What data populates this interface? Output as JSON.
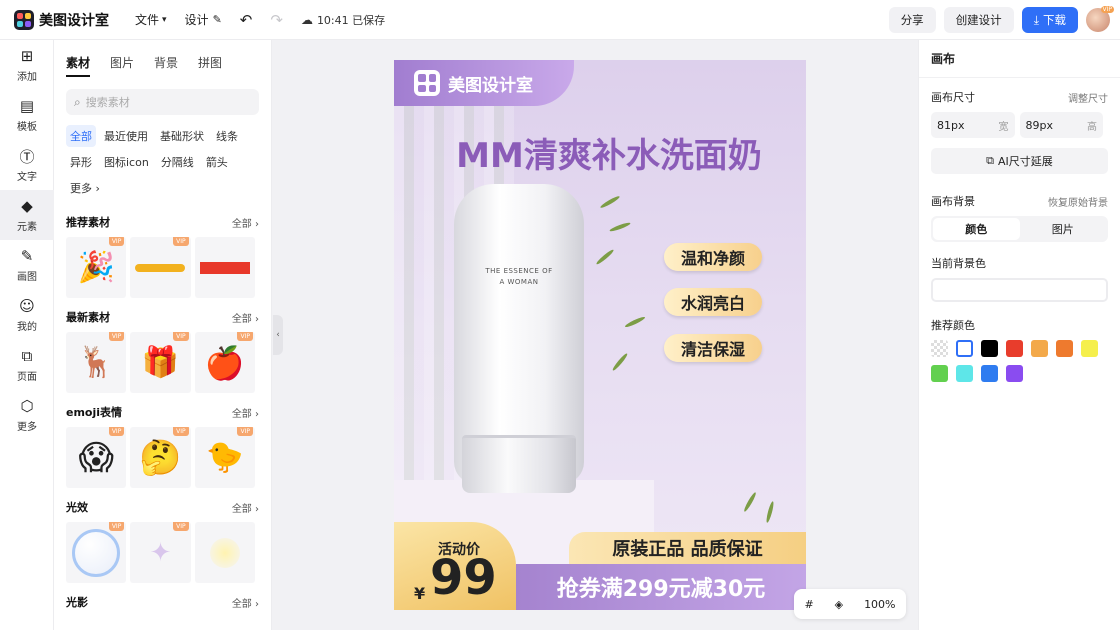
{
  "app": {
    "name": "美图设计室"
  },
  "menu": {
    "file": "文件",
    "design": "设计",
    "saved_status": "10:41 已保存"
  },
  "top_actions": {
    "share": "分享",
    "create": "创建设计",
    "download": "下载"
  },
  "avatar": {
    "vip_label": "VIP"
  },
  "rail": [
    {
      "label": "添加",
      "icon": "plus-square-icon"
    },
    {
      "label": "模板",
      "icon": "template-icon"
    },
    {
      "label": "文字",
      "icon": "text-icon"
    },
    {
      "label": "元素",
      "icon": "elements-icon"
    },
    {
      "label": "画图",
      "icon": "draw-icon"
    },
    {
      "label": "我的",
      "icon": "user-icon"
    },
    {
      "label": "页面",
      "icon": "add-page-icon"
    },
    {
      "label": "更多",
      "icon": "more-icon"
    }
  ],
  "panel": {
    "tabs": [
      "素材",
      "图片",
      "背景",
      "拼图"
    ],
    "search_placeholder": "搜索素材",
    "chips": [
      "全部",
      "最近使用",
      "基础形状",
      "线条",
      "异形",
      "图标icon",
      "分隔线",
      "箭头",
      "更多"
    ],
    "sections": [
      {
        "title": "推荐素材",
        "all": "全部"
      },
      {
        "title": "最新素材",
        "all": "全部"
      },
      {
        "title": "emoji表情",
        "all": "全部"
      },
      {
        "title": "光效",
        "all": "全部"
      },
      {
        "title": "光影",
        "all": "全部"
      }
    ],
    "vip_badge": "VIP"
  },
  "poster": {
    "brand": "美图设计室",
    "title": "MM清爽补水洗面奶",
    "bottle_text_line1": "THE ESSENCE OF",
    "bottle_text_line2": "A WOMAN",
    "features": [
      "温和净颜",
      "水润亮白",
      "清洁保湿"
    ],
    "price_label": "活动价",
    "price_symbol": "¥",
    "price_value": "99",
    "guarantee": "原装正品 品质保证",
    "coupon": "抢券满299元减30元"
  },
  "zoom": {
    "level": "100%"
  },
  "right_panel": {
    "title": "画布",
    "size_label": "画布尺寸",
    "adjust_size": "调整尺寸",
    "width_value": "81px",
    "width_unit": "宽",
    "height_value": "89px",
    "height_unit": "高",
    "ai_extend": "AI尺寸延展",
    "bg_label": "画布背景",
    "restore_bg": "恢复原始背景",
    "seg_color": "颜色",
    "seg_image": "图片",
    "current_bg": "当前背景色",
    "recommended": "推荐颜色",
    "swatches": [
      "transparent",
      "#ffffff",
      "#000000",
      "#e83d2c",
      "#f3a94a",
      "#ee7a2e",
      "#f5ef4c",
      "#62d04f",
      "#5ee6e8",
      "#2f7cf0",
      "#8a4cf0"
    ]
  }
}
